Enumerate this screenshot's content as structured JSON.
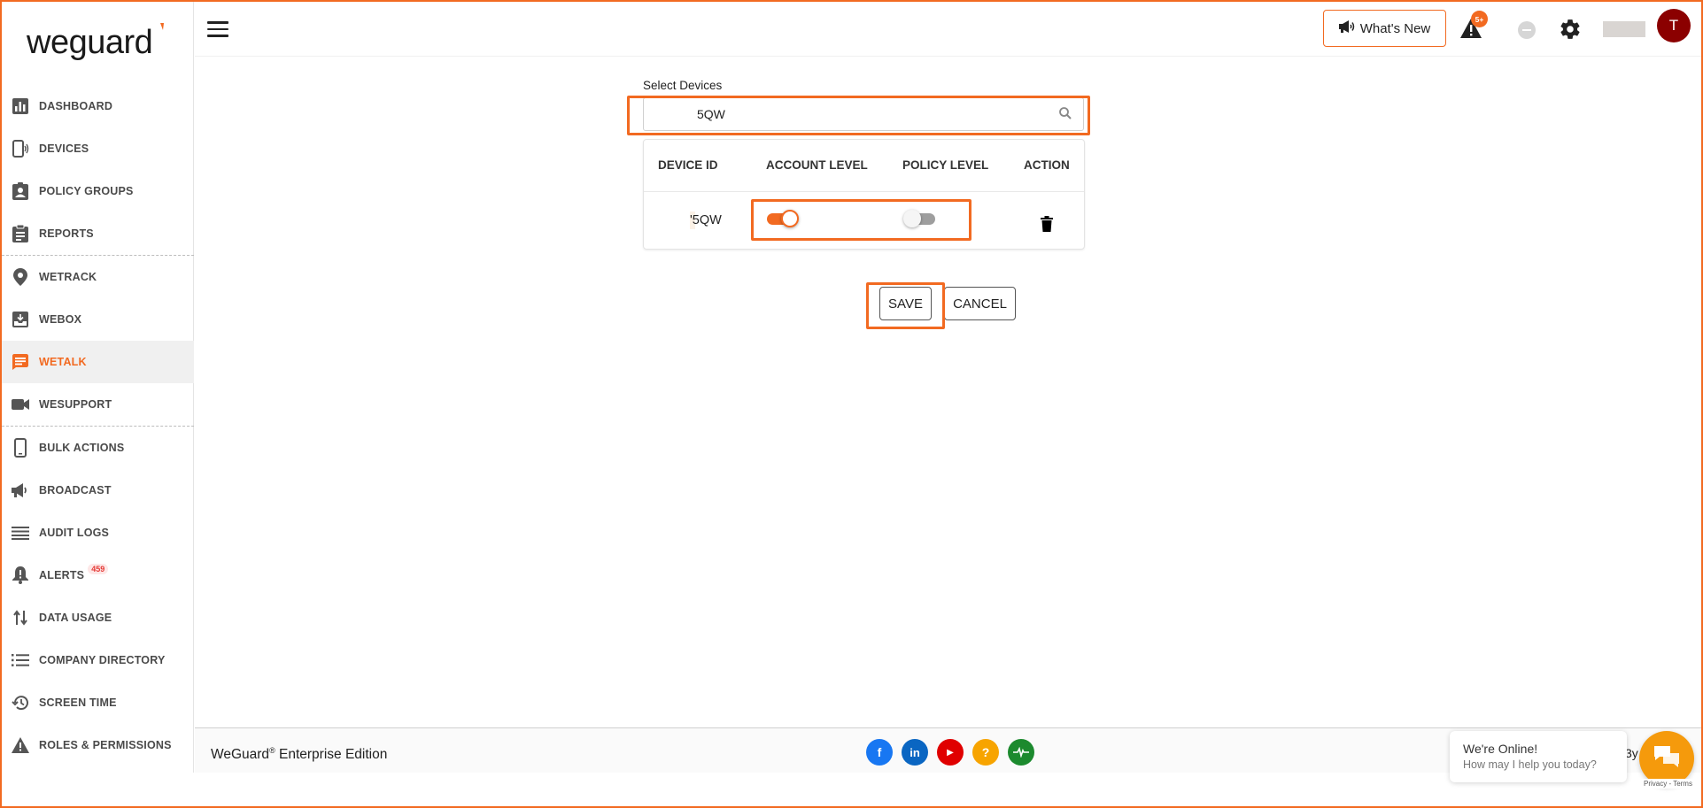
{
  "brand": {
    "logo_text": "weguard",
    "accent": "#f26a21"
  },
  "sidebar": {
    "items": [
      {
        "key": "dashboard",
        "label": "DASHBOARD",
        "icon": "bar-chart-icon"
      },
      {
        "key": "devices",
        "label": "DEVICES",
        "icon": "devices-icon"
      },
      {
        "key": "policy-groups",
        "label": "POLICY GROUPS",
        "icon": "badge-icon"
      },
      {
        "key": "reports",
        "label": "REPORTS",
        "icon": "clipboard-icon"
      },
      {
        "key": "wetrack",
        "label": "WETRACK",
        "icon": "location-pin-icon"
      },
      {
        "key": "webox",
        "label": "WEBOX",
        "icon": "inbox-icon"
      },
      {
        "key": "wetalk",
        "label": "WETALK",
        "icon": "chat-icon"
      },
      {
        "key": "wesupport",
        "label": "WESUPPORT",
        "icon": "video-camera-icon"
      },
      {
        "key": "bulk-actions",
        "label": "BULK ACTIONS",
        "icon": "phone-icon"
      },
      {
        "key": "broadcast",
        "label": "BROADCAST",
        "icon": "megaphone-icon"
      },
      {
        "key": "audit-logs",
        "label": "AUDIT LOGS",
        "icon": "list-lines-icon"
      },
      {
        "key": "alerts",
        "label": "ALERTS",
        "icon": "bell-icon",
        "badge": "459"
      },
      {
        "key": "data-usage",
        "label": "DATA USAGE",
        "icon": "arrows-updown-icon"
      },
      {
        "key": "company-directory",
        "label": "COMPANY DIRECTORY",
        "icon": "bulleted-list-icon"
      },
      {
        "key": "screen-time",
        "label": "SCREEN TIME",
        "icon": "history-icon"
      },
      {
        "key": "roles-permissions",
        "label": "ROLES & PERMISSIONS",
        "icon": "warning-triangle-icon"
      }
    ],
    "active": "wetalk"
  },
  "header": {
    "whats_new_label": "What's New",
    "alert_count": "5+",
    "avatar_initial": "T"
  },
  "main": {
    "select_label": "Select Devices",
    "search_value": "5QW",
    "table": {
      "headers": [
        "DEVICE ID",
        "ACCOUNT LEVEL",
        "POLICY LEVEL",
        "ACTION"
      ],
      "rows": [
        {
          "device_id": "'5QW",
          "account_level": true,
          "policy_level": false
        }
      ]
    },
    "save_label": "SAVE",
    "cancel_label": "CANCEL"
  },
  "footer": {
    "edition_brand": "WeGuard",
    "edition_reg": "®",
    "edition_rest": " Enterprise Edition",
    "tail_text": "3y",
    "social": [
      {
        "name": "facebook",
        "glyph": "f",
        "color": "#1877f2"
      },
      {
        "name": "linkedin",
        "glyph": "in",
        "color": "#0a66c2"
      },
      {
        "name": "youtube",
        "glyph": "▶",
        "color": "#e00000"
      },
      {
        "name": "help",
        "glyph": "?",
        "color": "#f7a400"
      },
      {
        "name": "status",
        "glyph": "~",
        "color": "#1c8a2e"
      }
    ]
  },
  "chat": {
    "title": "We're Online!",
    "subtitle": "How may I help you today?",
    "recaptcha": "Privacy - Terms"
  }
}
